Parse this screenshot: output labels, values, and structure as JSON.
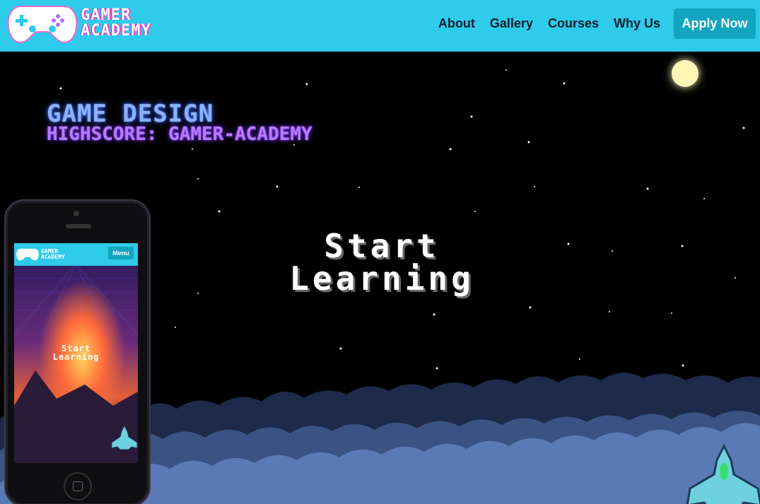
{
  "nav": {
    "logo_line1": "GAMER",
    "logo_line2": "ACADEMY",
    "links": [
      "About",
      "Gallery",
      "Courses",
      "Why Us"
    ],
    "apply_label": "Apply Now"
  },
  "hero": {
    "title_line1": "GAME DESIGN",
    "title_line2": "HIGHSCORE: GAMER-ACADEMY",
    "cta_line1": "Start",
    "cta_line2": "Learning"
  },
  "phone": {
    "logo_line1": "GAMER",
    "logo_line2": "ACADEMY",
    "menu_label": "Menu",
    "cta_line1": "Start",
    "cta_line2": "Learning"
  },
  "colors": {
    "nav_bg": "#2ecbea",
    "button_bg": "#12a5bf",
    "title_blue": "#8db0ff",
    "title_purple": "#b67bff"
  },
  "icons": [
    "gamepad-icon",
    "spaceship-icon",
    "moon-icon",
    "star-icon",
    "home-button-icon"
  ]
}
